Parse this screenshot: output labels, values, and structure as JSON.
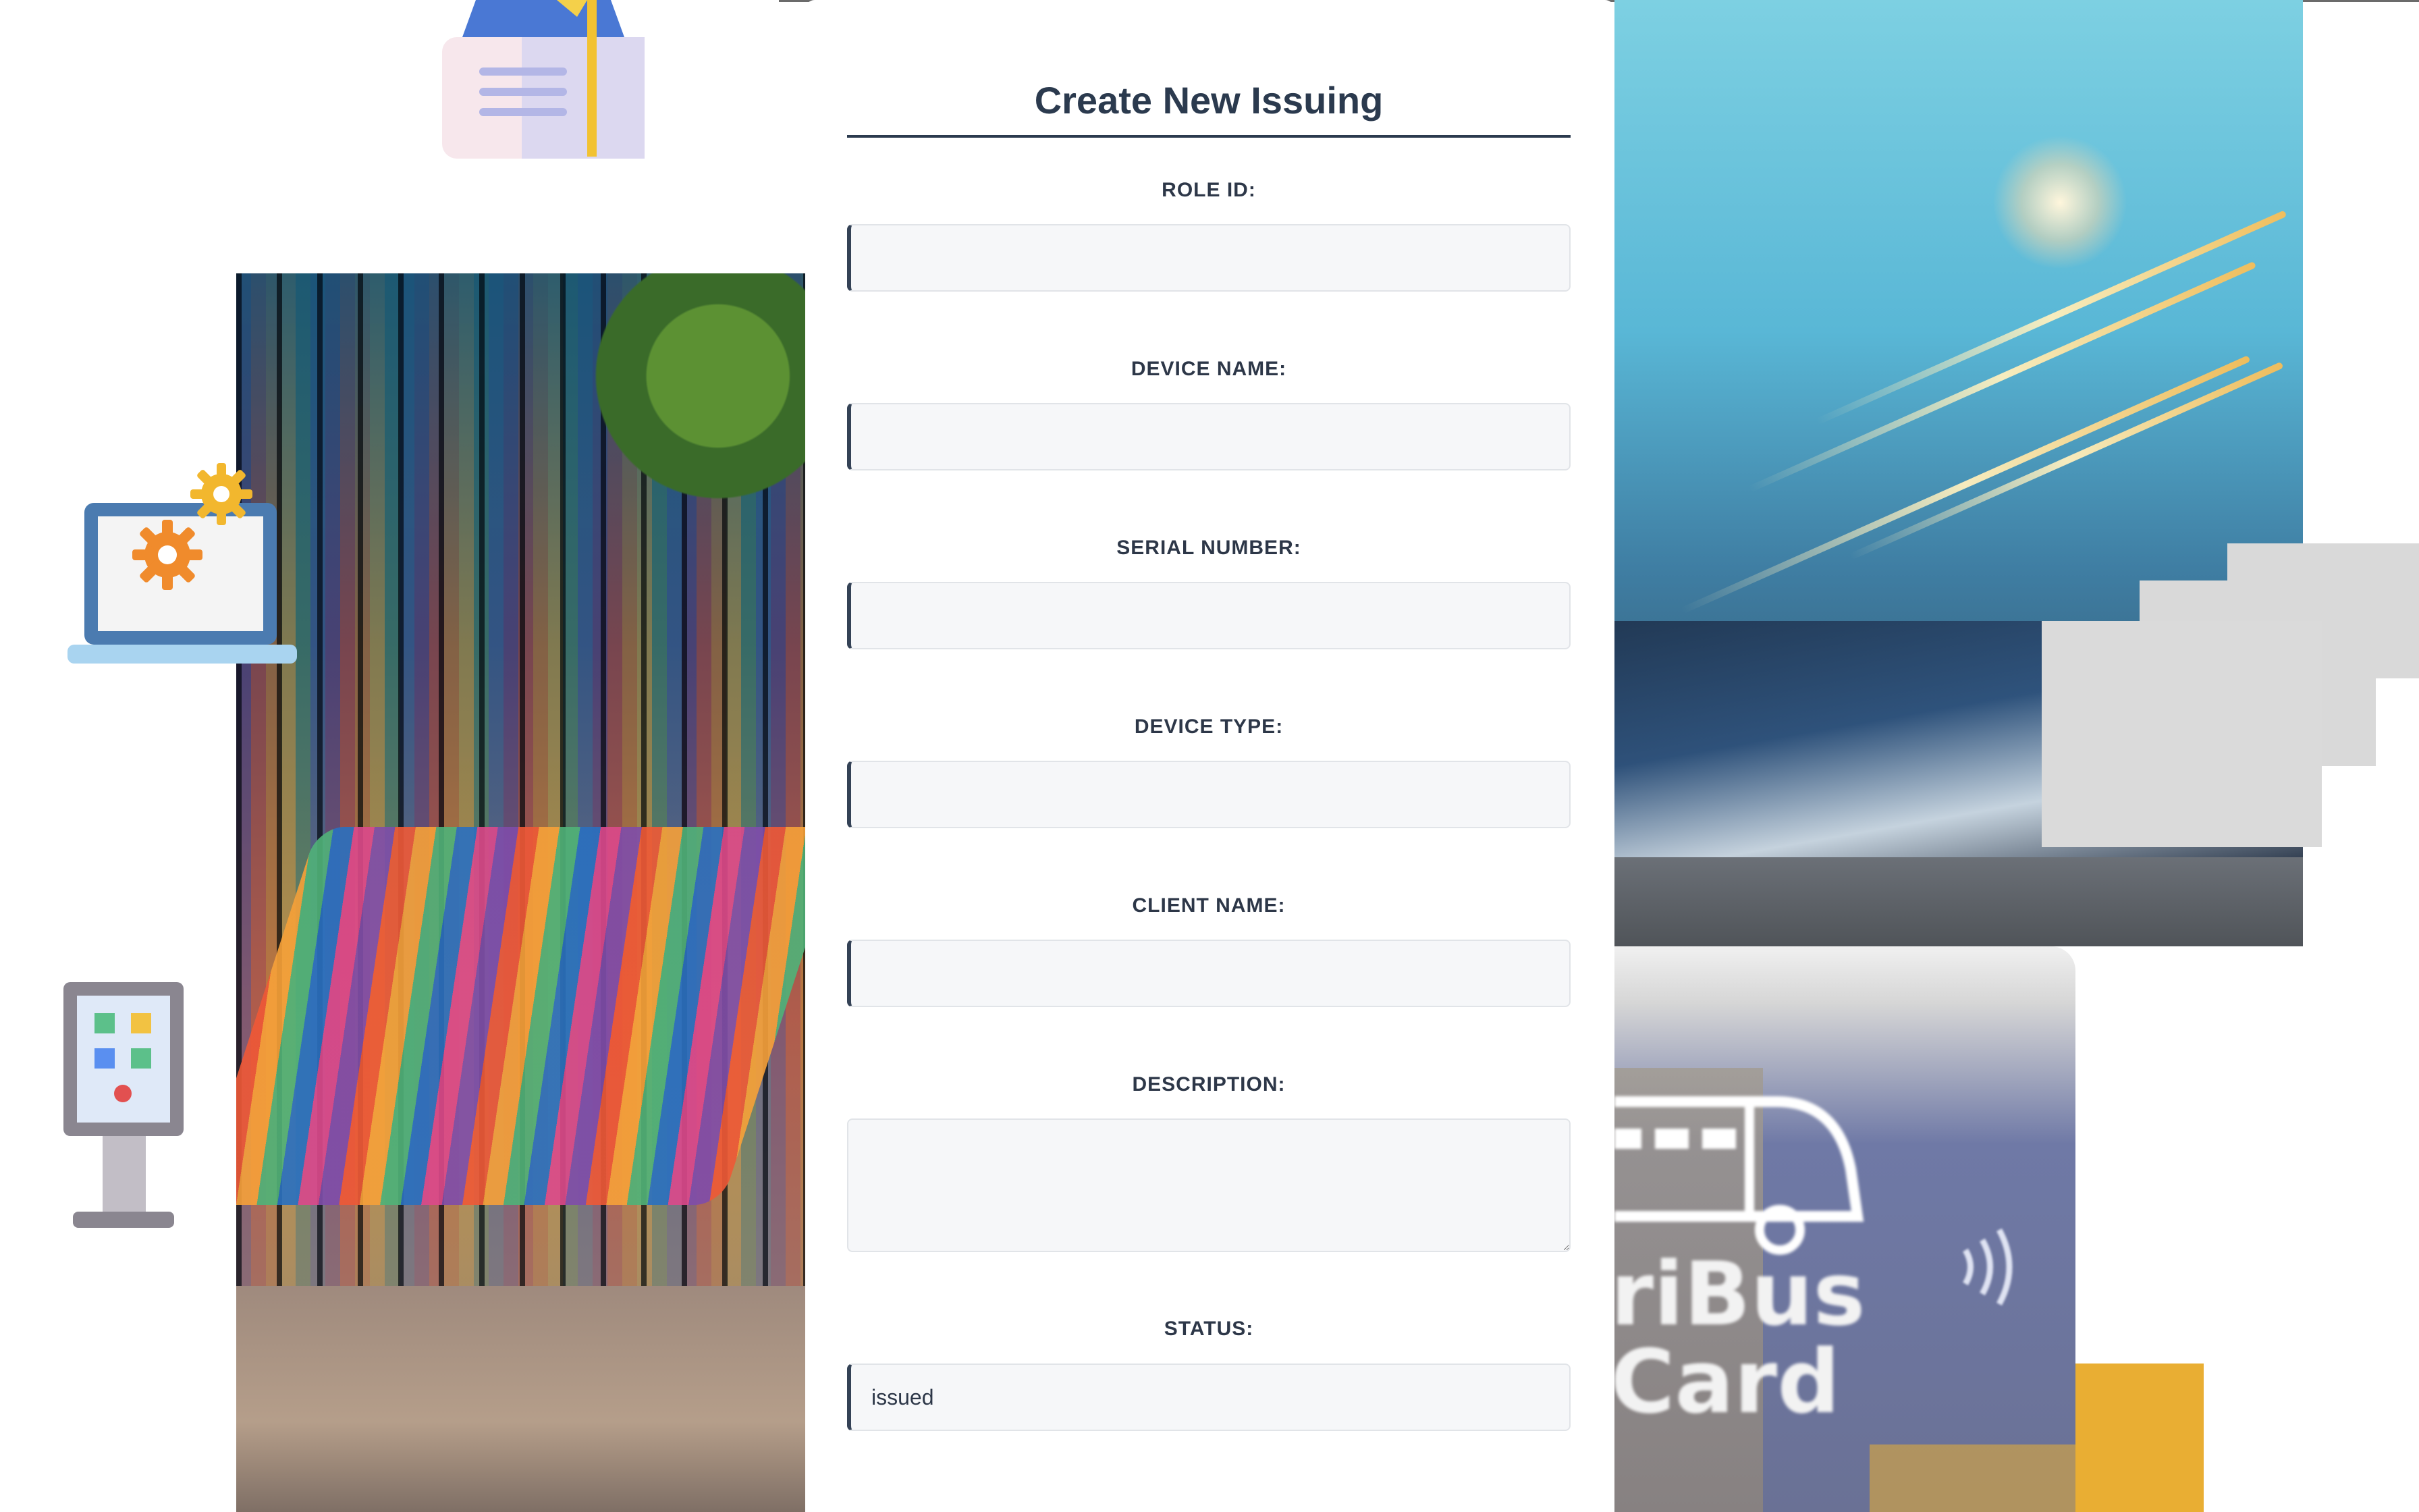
{
  "form": {
    "title": "Create New Issuing",
    "fields": [
      {
        "label": "ROLE ID:",
        "value": ""
      },
      {
        "label": "DEVICE NAME:",
        "value": ""
      },
      {
        "label": "SERIAL NUMBER:",
        "value": ""
      },
      {
        "label": "DEVICE TYPE:",
        "value": ""
      },
      {
        "label": "CLIENT NAME:",
        "value": ""
      },
      {
        "label": "DESCRIPTION:",
        "value": ""
      },
      {
        "label": "STATUS:",
        "value": "issued"
      }
    ]
  },
  "card": {
    "text": "riBus\nCard"
  },
  "colors": {
    "title": "#2b3a4e",
    "input_bg": "#f6f7f9",
    "input_accent": "#344256",
    "accent_yellow": "#e9ae33",
    "gear_orange": "#f08b2c"
  },
  "icons": [
    "document-icon",
    "laptop-gear-icon",
    "kiosk-icon",
    "bus-icon",
    "contactless-icon"
  ]
}
